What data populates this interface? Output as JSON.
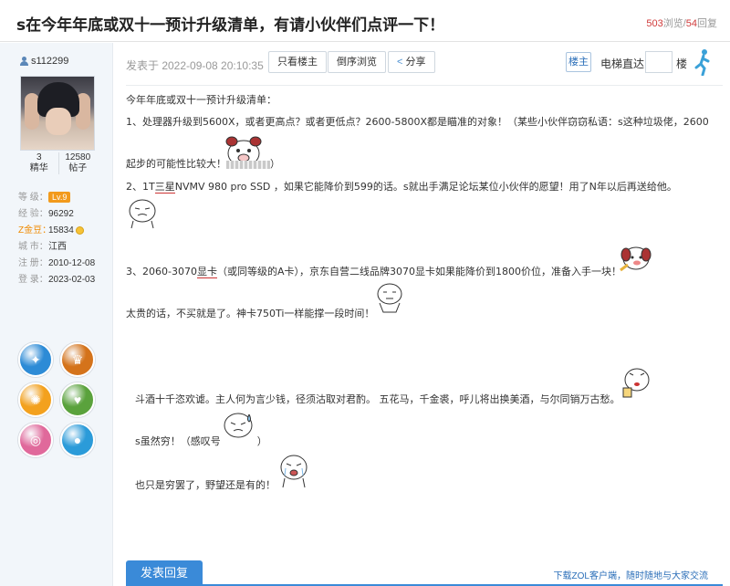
{
  "thread": {
    "title": "s在今年年底或双十一预计升级清单，有请小伙伴们点评一下！",
    "views": "503",
    "views_label": "浏览",
    "separator": "/",
    "replies": "54",
    "replies_label": "回复"
  },
  "author": {
    "username": "s112299",
    "essence_count": "3",
    "essence_label": "精华",
    "posts_count": "12580",
    "posts_label": "帖子",
    "level_label": "等  级：",
    "level": "Lv.9",
    "exp_label": "经  验：",
    "exp": "96292",
    "zcoin_label": "Z金豆：",
    "zcoin": "15834",
    "city_label": "城  市：",
    "city": "江西",
    "register_label": "注  册：",
    "register_date": "2010-12-08",
    "login_label": "登  录：",
    "login_date": "2023-02-03",
    "medal_colors": [
      "#2d8bd6",
      "#d4731b",
      "#f3a11e",
      "#5aa23c",
      "#e0699b",
      "#2b9bd9"
    ]
  },
  "toolbar": {
    "post_date": "发表于 2022-09-08 20:10:35",
    "only_op_label": "只看楼主",
    "reverse_label": "倒序浏览",
    "share_label": "分享",
    "op_badge": "楼主",
    "lift_label": "电梯直达",
    "floor_label": "楼"
  },
  "post": {
    "line1": "今年年底或双十一预计升级清单：",
    "line2": "1、处理器升级到5600X，或者更高点？或者更低点？2600-5800X都是瞄准的对象！（某些小伙伴窃窃私语：s这种垃圾佬，2600",
    "line3a": "起步的可能性比较大！",
    "line3b": "）",
    "line4a": "2、1T",
    "line4_brand": "三星",
    "line4b": "NVMV 980 pro SSD ，如果它能降价到599的话。s就出手满足论坛某位小伙伴的愿望！用了N年以后再送给他。",
    "line5a": "3、2060-3070",
    "line5_brand": "显卡",
    "line5b": "（或同等级的A卡），京东自营二线品牌3070显卡如果能降价到1800价位，准备入手一块！",
    "line6": "太贵的话，不买就是了。神卡750Ti一样能撑一段时间！",
    "line7": "斗酒十千恣欢谑。主人何为言少钱，径须沽取对君酌。 五花马，千金裘，呼儿将出换美酒，与尔同销万古愁。",
    "line8a": "s虽然穷！（感叹号",
    "line8b": "）",
    "line9": "也只是穷罢了，野望还是有的！"
  },
  "footer": {
    "reply_tab": "发表回复",
    "client_link": "下载ZOL客户端，随时随地与大家交流"
  }
}
